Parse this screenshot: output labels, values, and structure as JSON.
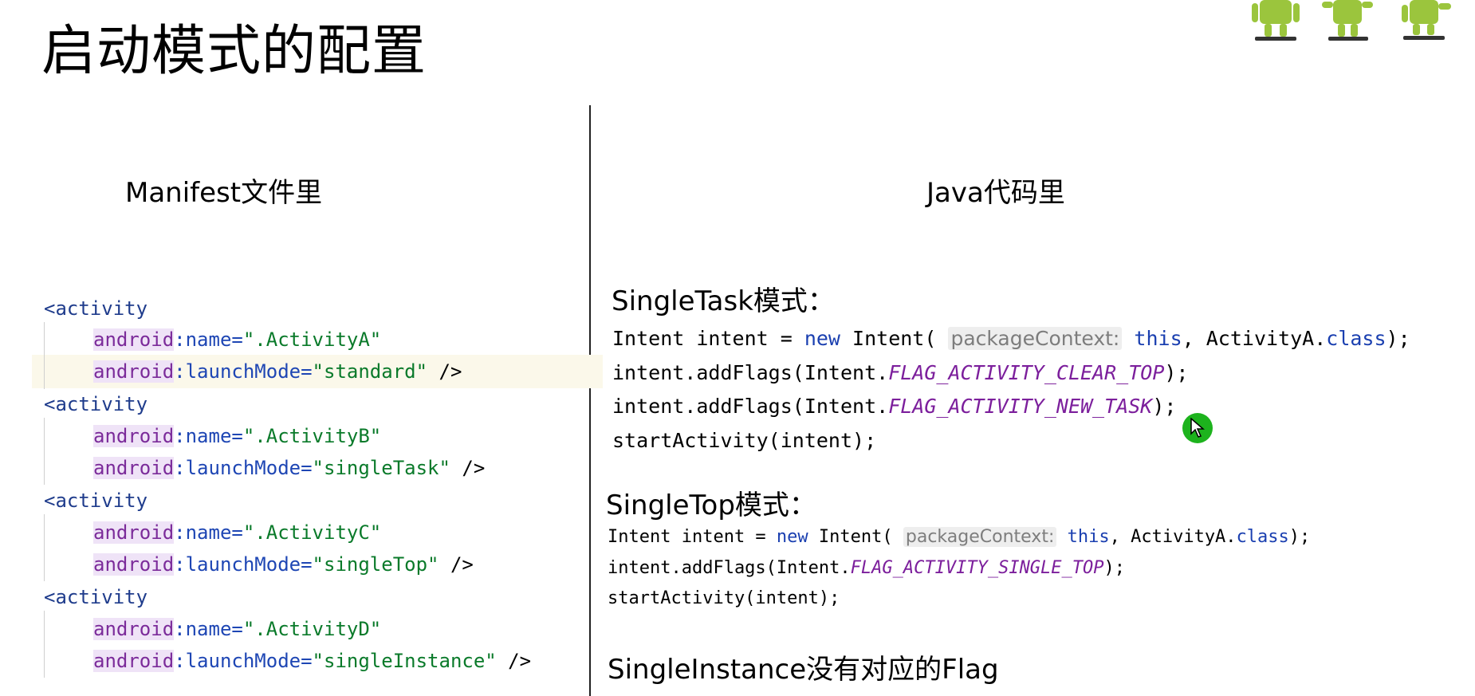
{
  "title": "启动模式的配置",
  "left_heading": "Manifest文件里",
  "right_heading": "Java代码里",
  "manifest": {
    "tag_open": "<activity",
    "ns": "android",
    "name_attr": ":name=",
    "launch_attr": ":launchMode=",
    "close": " />",
    "activities": [
      {
        "name": "\".ActivityA\"",
        "mode": "\"standard\""
      },
      {
        "name": "\".ActivityB\"",
        "mode": "\"singleTask\""
      },
      {
        "name": "\".ActivityC\"",
        "mode": "\"singleTop\""
      },
      {
        "name": "\".ActivityD\"",
        "mode": "\"singleInstance\""
      }
    ]
  },
  "java": {
    "single_task": {
      "heading": "SingleTask模式：",
      "line1": {
        "a": "Intent intent = ",
        "kw1": "new",
        "b": " Intent( ",
        "hint": "packageContext:",
        "kw2": "this",
        "c": ", ActivityA.",
        "kw3": "class",
        "d": ");"
      },
      "line2": {
        "a": "intent.addFlags(Intent.",
        "flag": "FLAG_ACTIVITY_CLEAR_TOP",
        "b": ");"
      },
      "line3": {
        "a": "intent.addFlags(Intent.",
        "flag": "FLAG_ACTIVITY_NEW_TASK",
        "b": ");"
      },
      "line4": "startActivity(intent);"
    },
    "single_top": {
      "heading": "SingleTop模式：",
      "line1": {
        "a": "Intent intent = ",
        "kw1": "new",
        "b": " Intent( ",
        "hint": "packageContext:",
        "kw2": "this",
        "c": ", ActivityA.",
        "kw3": "class",
        "d": ");"
      },
      "line2": {
        "a": "intent.addFlags(Intent.",
        "flag": "FLAG_ACTIVITY_SINGLE_TOP",
        "b": ");"
      },
      "line3": "startActivity(intent);"
    },
    "single_instance_note": "SingleInstance没有对应的Flag"
  },
  "colors": {
    "tag": "#1f3c8c",
    "namespace": "#7b2b9a",
    "attribute": "#1e46b4",
    "string": "#0a7a2a",
    "keyword": "#1a3fb0",
    "constant": "#7c1f9c",
    "android_green": "#9bc53d",
    "cursor": "#1db31d"
  },
  "icons": [
    "android-robot-icon",
    "cursor-icon"
  ]
}
